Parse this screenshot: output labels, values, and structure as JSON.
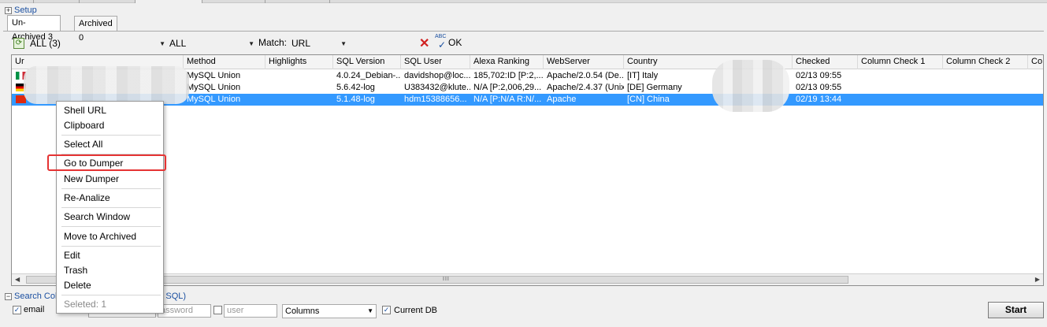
{
  "setup": {
    "label": "Setup"
  },
  "archive_tabs": [
    {
      "label": "Un-Archived 3",
      "active": true
    },
    {
      "label": "Archived 0",
      "active": false
    }
  ],
  "filter": {
    "group_value": "ALL (3)",
    "second_value": "ALL",
    "match_label": "Match:",
    "match_value": "URL",
    "ok_label": "OK",
    "abc_icon_text": "ABC"
  },
  "columns": [
    "Ur",
    "Method",
    "Highlights",
    "SQL Version",
    "SQL User",
    "Alexa Ranking",
    "WebServer",
    "Country",
    "Checked",
    "Column Check 1",
    "Column Check 2",
    "Co"
  ],
  "rows": [
    {
      "flag": "it",
      "method": "MySQL Union",
      "highlights": "",
      "sql_version": "4.0.24_Debian-...",
      "sql_user": "davidshop@loc...",
      "alexa": "185,702:ID [P:2,...",
      "webserver": "Apache/2.0.54 (De...",
      "country": "[IT] Italy",
      "checked": "02/13 09:55",
      "selected": false
    },
    {
      "flag": "de",
      "method": "MySQL Union",
      "highlights": "",
      "sql_version": "5.6.42-log",
      "sql_user": "U383432@klute...",
      "alexa": "N/A [P:2,006,29...",
      "webserver": "Apache/2.4.37 (Unix)",
      "country": "[DE] Germany",
      "checked": "02/13 09:55",
      "selected": false
    },
    {
      "flag": "cn",
      "method": "MySQL Union",
      "highlights": "",
      "sql_version": "5.1.48-log",
      "sql_user": "hdm15388656...",
      "alexa": "N/A [P:N/A R:N/...",
      "webserver": "Apache",
      "country": "[CN] China",
      "checked": "02/19 13:44",
      "selected": true
    }
  ],
  "scrollbar": {
    "grip": "III"
  },
  "context_menu": {
    "items": [
      "Shell URL",
      "Clipboard",
      "Select All",
      "Go to Dumper",
      "New Dumper",
      "Re-Analize",
      "Search Window",
      "Move to Archived",
      "Edit",
      "Trash",
      "Delete"
    ],
    "footer": "Seleted: 1"
  },
  "search": {
    "label": "Search Colun",
    "sql_label": "S SQL)",
    "email_label": "email",
    "password_placeholder": "assword",
    "user_placeholder": "user",
    "columns_select": "Columns",
    "current_db_label": "Current DB",
    "start_label": "Start"
  },
  "colors": {
    "selection": "#3399ff",
    "highlight_box": "#e53333",
    "link": "#1a4fa0"
  }
}
